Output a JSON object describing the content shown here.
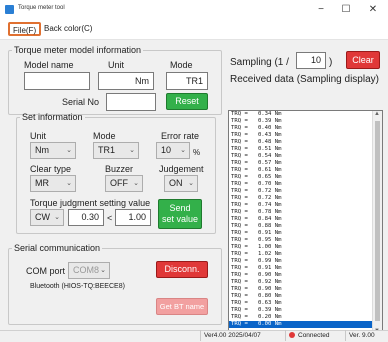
{
  "window": {
    "title": "Torque meter tool",
    "minimize": "−",
    "maximize": "☐",
    "close": "✕"
  },
  "menu": {
    "file": "File(F)",
    "back_color": "Back color(C)"
  },
  "model_info": {
    "legend": "Torque meter model information",
    "model_name_label": "Model name",
    "model_name_value": "",
    "unit_label": "Unit",
    "unit_value": "Nm",
    "mode_label": "Mode",
    "mode_value": "TR1",
    "serial_label": "Serial No",
    "serial_value": "",
    "reset_button": "Reset"
  },
  "set_info": {
    "legend": "Set information",
    "unit_label": "Unit",
    "unit_value": "Nm",
    "mode_label": "Mode",
    "mode_value": "TR1",
    "error_rate_label": "Error rate",
    "error_rate_value": "10",
    "error_rate_unit": "%",
    "clear_type_label": "Clear type",
    "clear_type_value": "MR",
    "buzzer_label": "Buzzer",
    "buzzer_value": "OFF",
    "judgement_label": "Judgement",
    "judgement_value": "ON",
    "judgment_setting_label": "Torque judgment setting value",
    "judgment_mode_value": "CW",
    "judgment_low": "0.30",
    "judgment_sep": "<",
    "judgment_high": "1.00",
    "send_button_line1": "Send",
    "send_button_line2": "set value"
  },
  "sampling": {
    "label": "Sampling (1 /",
    "value": "10",
    "close_paren": ")",
    "clear_button": "Clear"
  },
  "received": {
    "label": "Received data (Sampling display)",
    "lines": [
      "TRQ =   0.34 Nm",
      "TRQ =   0.39 Nm",
      "TRQ =   0.40 Nm",
      "TRQ =   0.43 Nm",
      "TRQ =   0.48 Nm",
      "TRQ =   0.51 Nm",
      "TRQ =   0.54 Nm",
      "TRQ =   0.57 Nm",
      "TRQ =   0.61 Nm",
      "TRQ =   0.65 Nm",
      "TRQ =   0.70 Nm",
      "TRQ =   0.72 Nm",
      "TRQ =   0.72 Nm",
      "TRQ =   0.74 Nm",
      "TRQ =   0.78 Nm",
      "TRQ =   0.84 Nm",
      "TRQ =   0.88 Nm",
      "TRQ =   0.91 Nm",
      "TRQ =   0.95 Nm",
      "TRQ =   1.00 Nm",
      "TRQ =   1.02 Nm",
      "TRQ =   0.99 Nm",
      "TRQ =   0.91 Nm",
      "TRQ =   0.90 Nm",
      "TRQ =   0.92 Nm",
      "TRQ =   0.90 Nm",
      "TRQ =   0.80 Nm",
      "TRQ =   0.63 Nm",
      "TRQ =   0.39 Nm",
      "TRQ =   0.20 Nm",
      "TRQ =   0.00 Nm"
    ]
  },
  "serial": {
    "legend": "Serial communication",
    "com_port_label": "COM port",
    "com_port_value": "COM8",
    "disconnect_button": "Disconn.",
    "bluetooth_text": "Bluetooth (HIOS-TQ:BEECE8)",
    "get_bt_button": "Get BT name"
  },
  "status": {
    "version": "Ver4.00 2025/04/07",
    "connection": "Connected",
    "device_version": "Ver. 9.00"
  },
  "colors": {
    "accent_green": "#33b04a",
    "accent_red": "#e03838",
    "selection": "#0a64c8",
    "highlight_border": "#e07030"
  }
}
